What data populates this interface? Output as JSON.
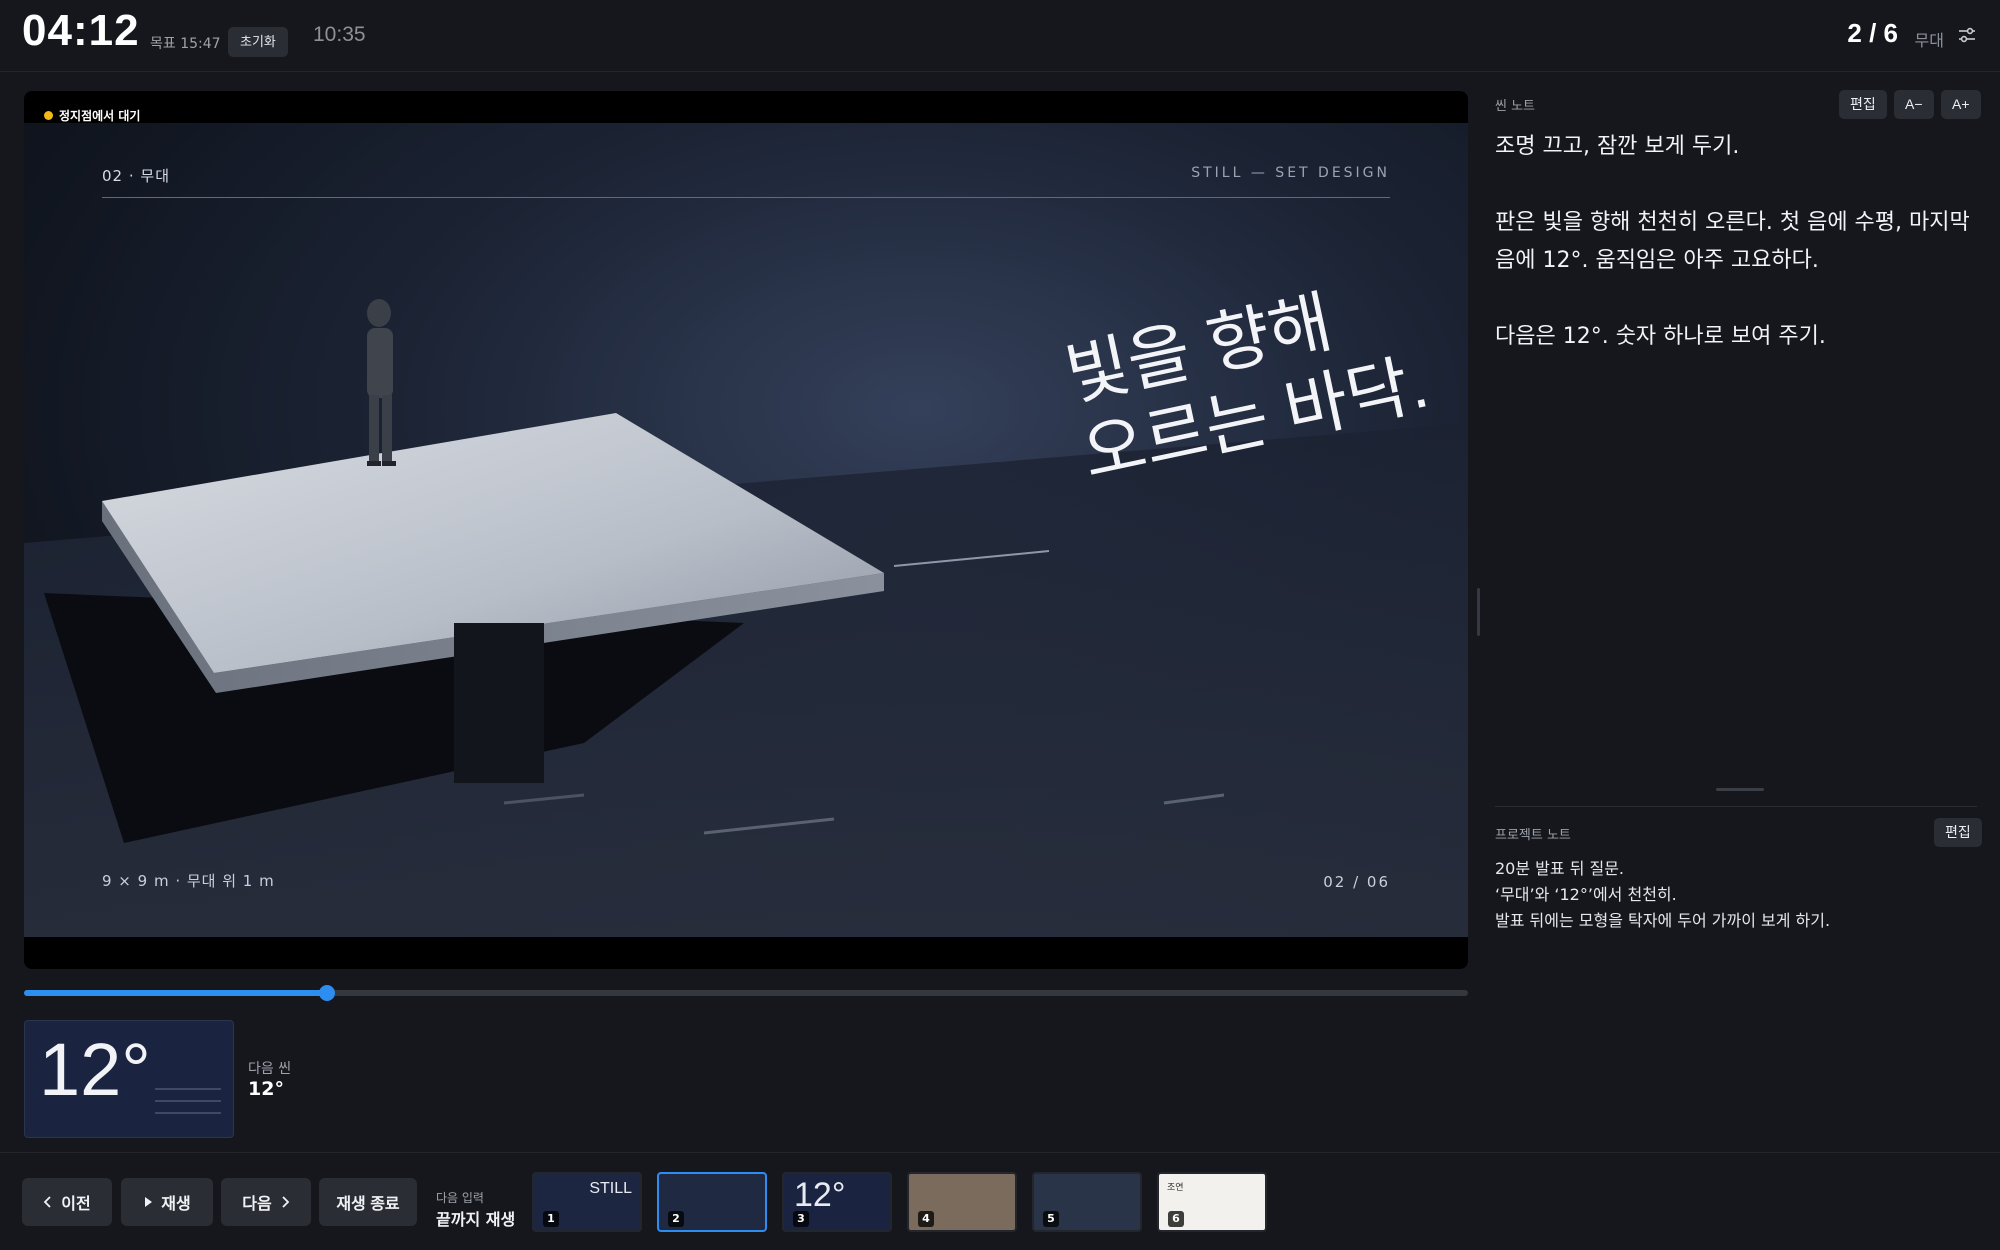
{
  "header": {
    "timer": "04:12",
    "target": "목표 15:47",
    "reset_label": "초기화",
    "clock": "10:35",
    "counter": "2 / 6",
    "counter_label": "무대",
    "settings_icon": "sliders-icon"
  },
  "stage": {
    "status": "정지점에서 대기",
    "status_color": "#f4b81b",
    "slide": {
      "label_top_left": "02 · 무대",
      "label_top_right": "STILL — SET DESIGN",
      "headline": "빛을 향해\n오르는 바닥.",
      "label_bottom_left": "9 × 9 m · 무대 위 1 m",
      "label_bottom_right": "02 / 06"
    }
  },
  "progress": {
    "fraction": 0.21,
    "color": "#2e8df0"
  },
  "next_scene": {
    "label": "다음 씬",
    "value": "12°",
    "thumb_big": "12°"
  },
  "scene_notes": {
    "title": "씬 노트",
    "edit_label": "편집",
    "font_down_label": "A−",
    "font_up_label": "A+",
    "body": "조명 끄고, 잠깐 보게 두기.\n\n판은 빛을 향해 천천히 오른다. 첫 음에 수평, 마지막 음에 12°. 움직임은 아주 고요하다.\n\n다음은 12°. 숫자 하나로 보여 주기."
  },
  "project_notes": {
    "title": "프로젝트 노트",
    "edit_label": "편집",
    "body": "20분 발표 뒤 질문.\n‘무대’와 ‘12°’에서 천천히.\n발표 뒤에는 모형을 탁자에 두어 가까이 보게 하기."
  },
  "controls": {
    "prev_label": "이전",
    "play_label": "재생",
    "next_label": "다음",
    "stop_label": "재생 종료",
    "input_label": "다음 입력",
    "input_value": "끝까지 재생"
  },
  "thumbnails": [
    {
      "num": "1",
      "text": "STILL",
      "bg": "#1c2640",
      "active": false
    },
    {
      "num": "2",
      "text": "",
      "bg": "#1f2a42",
      "active": true
    },
    {
      "num": "3",
      "text": "12°",
      "bg": "#1a2440",
      "active": false
    },
    {
      "num": "4",
      "text": "",
      "bg": "#7a6b5c",
      "active": false
    },
    {
      "num": "5",
      "text": "",
      "bg": "#2a3448",
      "active": false
    },
    {
      "num": "6",
      "text": "조연",
      "bg": "#f2f1ee",
      "active": false
    }
  ]
}
